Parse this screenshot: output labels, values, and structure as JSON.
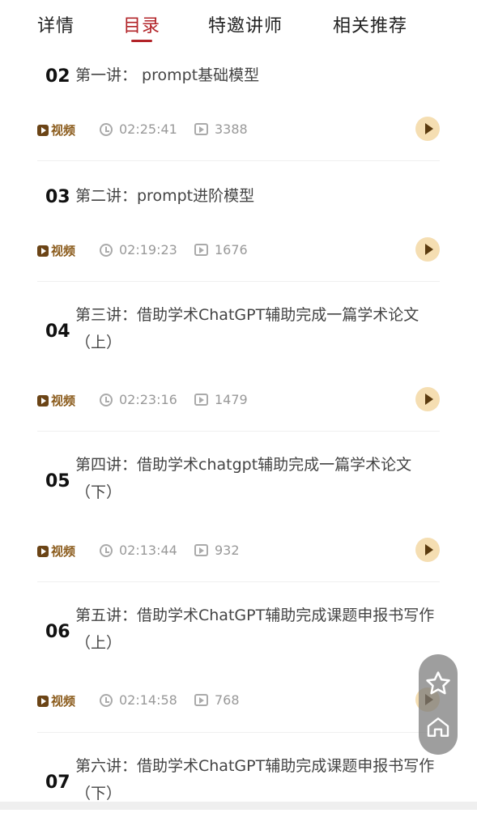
{
  "tabs": [
    {
      "label": "详情"
    },
    {
      "label": "目录"
    },
    {
      "label": "特邀讲师"
    },
    {
      "label": "相关推荐"
    }
  ],
  "items": [
    {
      "num": "02",
      "title": "第一讲： prompt基础模型",
      "badge": "视频",
      "duration": "02:25:41",
      "views": "3388"
    },
    {
      "num": "03",
      "title": "第二讲：prompt进阶模型",
      "badge": "视频",
      "duration": "02:19:23",
      "views": "1676"
    },
    {
      "num": "04",
      "title": "第三讲：借助学术ChatGPT辅助完成一篇学术论文（上）",
      "badge": "视频",
      "duration": "02:23:16",
      "views": "1479"
    },
    {
      "num": "05",
      "title": "第四讲：借助学术chatgpt辅助完成一篇学术论文（下）",
      "badge": "视频",
      "duration": "02:13:44",
      "views": "932"
    },
    {
      "num": "06",
      "title": "第五讲：借助学术ChatGPT辅助完成课题申报书写作（上）",
      "badge": "视频",
      "duration": "02:14:58",
      "views": "768"
    },
    {
      "num": "07",
      "title": "第六讲：借助学术ChatGPT辅助完成课题申报书写作（下）"
    }
  ],
  "floating": {
    "icons": [
      "star-icon",
      "home-icon"
    ]
  },
  "colors": {
    "accent": "#b22328",
    "badge": "#8a5a1a",
    "play_bg": "#f5deb2"
  }
}
